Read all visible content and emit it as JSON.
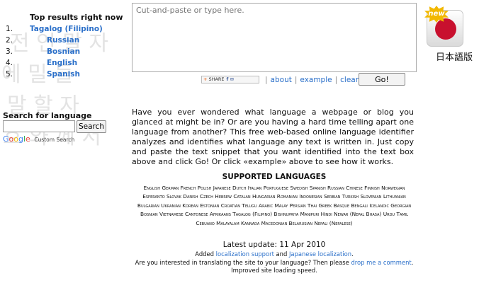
{
  "background_glyphs": [
    "전 언 말 자",
    "에 밀 들",
    "말 할 자",
    "호 와 께 서"
  ],
  "top_results": {
    "title": "Top results right now",
    "items": [
      {
        "num": "1.",
        "label": "Tagalog (Filipino)"
      },
      {
        "num": "2.",
        "label": "Russian"
      },
      {
        "num": "3.",
        "label": "Bosnian"
      },
      {
        "num": "4.",
        "label": "English"
      },
      {
        "num": "5.",
        "label": "Spanish"
      }
    ]
  },
  "search": {
    "label": "Search for language",
    "input_value": "",
    "button_label": "Search",
    "google": [
      "G",
      "o",
      "o",
      "g",
      "l",
      "e"
    ],
    "custom_search": "Custom Search"
  },
  "input": {
    "placeholder": "Cut-and-paste or type here.",
    "value": ""
  },
  "share": {
    "plus": "+",
    "label": "SHARE",
    "icons": "f ✉"
  },
  "toolbar": {
    "about": "about",
    "example": "example",
    "clear": "clear",
    "go": "Go!"
  },
  "jp_badge": {
    "new": "new",
    "text": "日本語版"
  },
  "intro": "Have you ever wondered what language a webpage or blog you glanced at might be in? Or are you having a hard time telling apart one language from another? This free web-based online language identifier analyzes and identifies what language any text is written in. Just copy and paste the text snippet that you want identified into the text box above and click Go! Or click «example» above to see how it works.",
  "supported": {
    "title": "SUPPORTED LANGUAGES",
    "languages": "English German French Polish Japanese Dutch Italian Portuguese Swedish Spanish Russian Chinese Finnish Norwegian Esperanto Slovak Danish Czech Hebrew Catalan Hungarian Romanian Indonesian Serbian Turkish Slovenian Lithuanian Bulgarian Ukranian Korean Estonian Croatian Telugu Arabic Malay Persian Thai Greek Basque Bengali Icelandic Georgian Bosnian Vietnamese Cantonese Afrikaans Tagalog (Filipino) Bishnupriya Manipuri Hindi Newar (Nepal Bhasa) Urdu Tamil Cebuano Malayalam Kannada Macedonian Belarusian Nepali (Nepalese)"
  },
  "latest": {
    "title": "Latest update: 11 Apr 2010",
    "line1_pre": "Added ",
    "line1_link1": "localization support",
    "line1_mid": " and ",
    "line1_link2": "Japanese localization",
    "line1_post": ".",
    "line2_pre": "Are you interested in translating the site to your language? Then please ",
    "line2_link": "drop me a comment",
    "line2_post": ".",
    "line3": "Improved site loading speed."
  },
  "colors": {
    "link": "#2a6fc9",
    "flag_red": "#c8102e",
    "new_badge": "#f2b800"
  }
}
